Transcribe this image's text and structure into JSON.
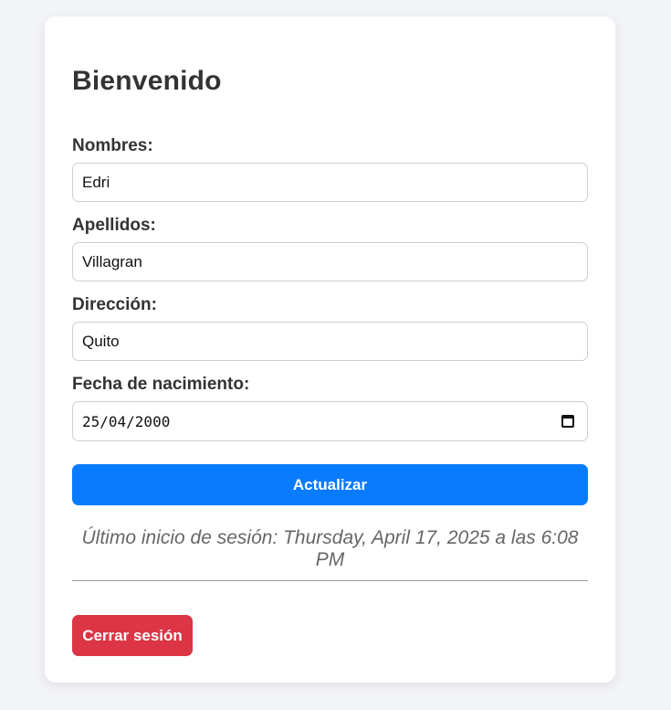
{
  "header": {
    "title": "Bienvenido"
  },
  "form": {
    "nombres": {
      "label": "Nombres:",
      "value": "Edri"
    },
    "apellidos": {
      "label": "Apellidos:",
      "value": "Villagran"
    },
    "direccion": {
      "label": "Dirección:",
      "value": "Quito"
    },
    "fecha_nacimiento": {
      "label": "Fecha de nacimiento:",
      "value": "25/04/2000",
      "icon": "calendar-icon"
    },
    "submit_label": "Actualizar"
  },
  "session": {
    "last_login_line1": "Último inicio de sesión: Thursday, April 17, 2025 a las 6:08",
    "last_login_line2": "PM",
    "logout_label": "Cerrar sesión"
  },
  "colors": {
    "primary": "#087bff",
    "danger": "#dc3545",
    "background": "#f3f4f8",
    "card": "#ffffff",
    "text": "#333333"
  }
}
